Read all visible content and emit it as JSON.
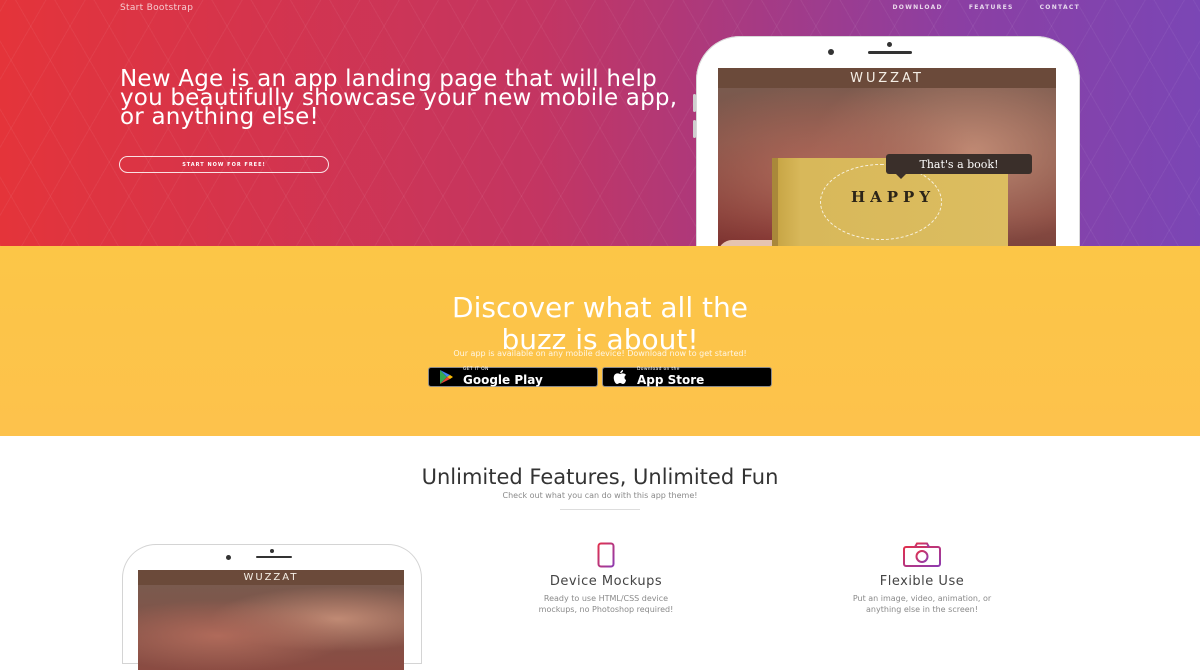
{
  "nav": {
    "brand": "Start Bootstrap",
    "links": [
      "DOWNLOAD",
      "FEATURES",
      "CONTACT"
    ]
  },
  "hero": {
    "headline": "New Age is an app landing page that will help you beautifully showcase your new mobile app, or anything else!",
    "cta": "START NOW FOR FREE!",
    "app_name": "WUZZAT",
    "book_title": "HAPPY",
    "bubble": "That's a book!"
  },
  "download": {
    "title_line1": "Discover what all the",
    "title_line2": "buzz is about!",
    "subtitle": "Our app is available on any mobile device! Download now to get started!",
    "google_small": "GET IT ON",
    "google_big": "Google Play",
    "apple_small": "Download on the",
    "apple_big": "App Store"
  },
  "features": {
    "title": "Unlimited Features, Unlimited Fun",
    "subtitle": "Check out what you can do with this app theme!",
    "app_name": "WUZZAT",
    "items": [
      {
        "title": "Device Mockups",
        "desc_line1": "Ready to use HTML/CSS device",
        "desc_line2": "mockups, no Photoshop required!",
        "icon": "phone-icon"
      },
      {
        "title": "Flexible Use",
        "desc_line1": "Put an image, video, animation, or",
        "desc_line2": "anything else in the screen!",
        "icon": "camera-icon"
      }
    ]
  },
  "colors": {
    "hero_start": "#e4343a",
    "hero_end": "#7b46b5",
    "download_bg": "#fdc24c",
    "icon_accent": "#c2286b"
  }
}
